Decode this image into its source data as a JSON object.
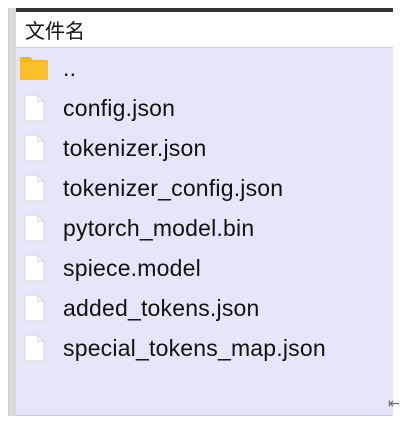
{
  "header": {
    "column_label": "文件名"
  },
  "files": [
    {
      "name": "..",
      "icon": "folder-icon",
      "kind": "folder"
    },
    {
      "name": "config.json",
      "icon": "file-icon",
      "kind": "file"
    },
    {
      "name": "tokenizer.json",
      "icon": "file-icon",
      "kind": "file"
    },
    {
      "name": "tokenizer_config.json",
      "icon": "file-icon",
      "kind": "file"
    },
    {
      "name": "pytorch_model.bin",
      "icon": "file-icon",
      "kind": "file"
    },
    {
      "name": "spiece.model",
      "icon": "file-icon",
      "kind": "file"
    },
    {
      "name": "added_tokens.json",
      "icon": "file-icon",
      "kind": "file"
    },
    {
      "name": "special_tokens_map.json",
      "icon": "file-icon",
      "kind": "file"
    }
  ],
  "colors": {
    "list_background": "#e6e6fb",
    "folder": "#f6b619",
    "file_fill": "#ffffff",
    "file_stroke": "#d6d6d6"
  }
}
